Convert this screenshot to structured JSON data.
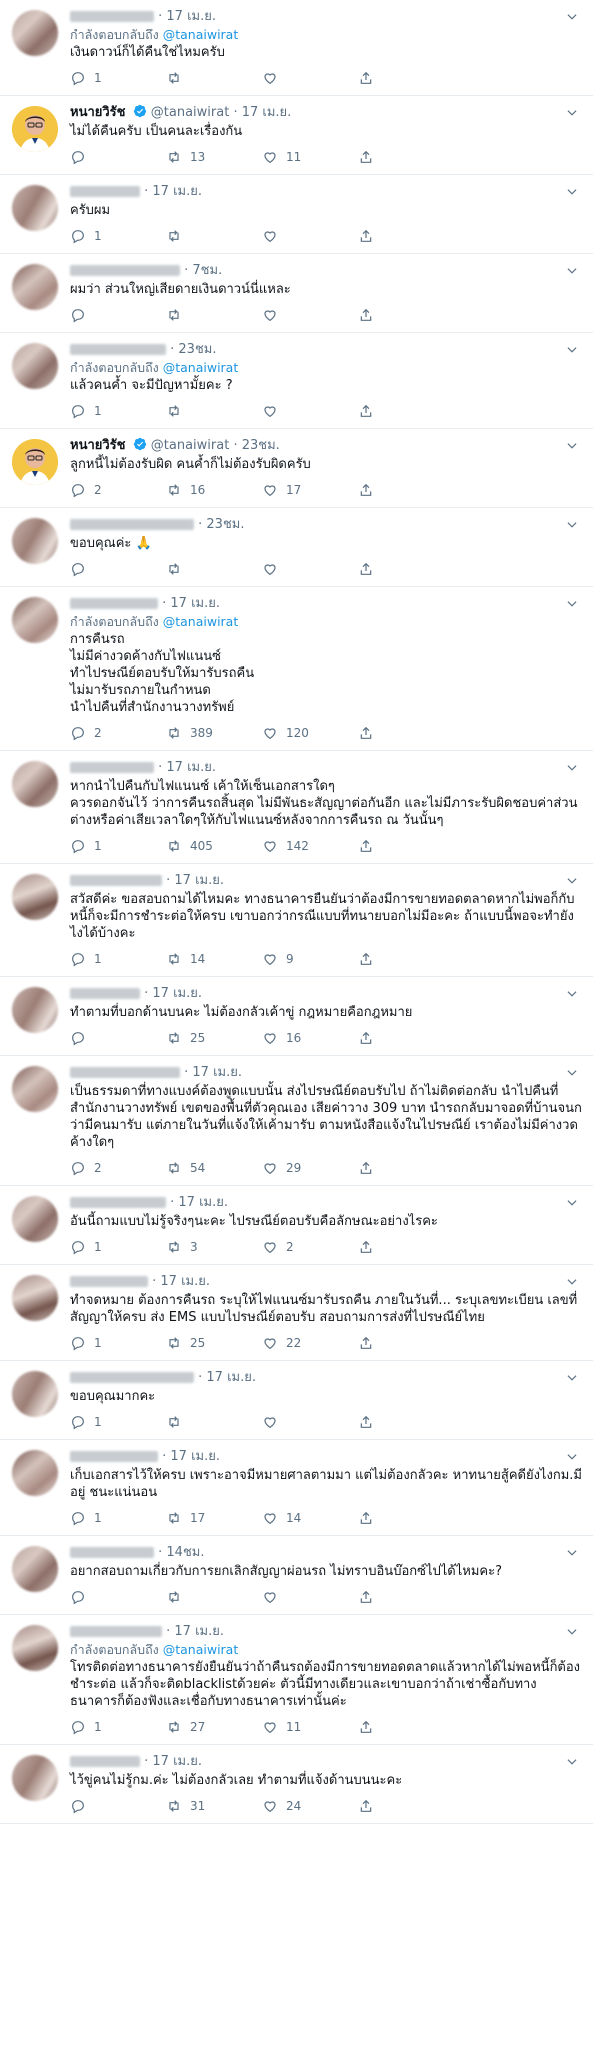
{
  "reply_prefix": "กำลังตอบกลับถึง",
  "reply_handle": "@tanaiwirat",
  "tweets": [
    {
      "name": "",
      "handle": "",
      "time": "17 เม.ย.",
      "reply": true,
      "text": "เงินดาวน์ก็ได้คืนใช่ไหมครับ",
      "replies": "1",
      "retweets": "",
      "likes": "",
      "avatar": "blur"
    },
    {
      "name": "หนายวิรัช",
      "handle": "@tanaiwirat",
      "time": "17 เม.ย.",
      "reply": false,
      "text": "ไม่ได้คืนครับ เป็นคนละเรื่องกัน",
      "replies": "",
      "retweets": "13",
      "likes": "11",
      "avatar": "person"
    },
    {
      "name": "",
      "handle": "",
      "time": "17 เม.ย.",
      "reply": false,
      "text": "ครับผม",
      "replies": "1",
      "retweets": "",
      "likes": "",
      "avatar": "blur"
    },
    {
      "name": "",
      "handle": "",
      "time": "7ชม.",
      "reply": false,
      "text": "ผมว่า ส่วนใหญ่เสียดายเงินดาวน์นี่แหละ",
      "replies": "",
      "retweets": "",
      "likes": "",
      "avatar": "blur"
    },
    {
      "name": "",
      "handle": "",
      "time": "23ชม.",
      "reply": true,
      "text": "แล้วคนค้ำ จะมีปัญหามั้ยคะ ?",
      "replies": "1",
      "retweets": "",
      "likes": "",
      "avatar": "blur"
    },
    {
      "name": "หนายวิรัช",
      "handle": "@tanaiwirat",
      "time": "23ชม.",
      "reply": false,
      "text": "ลูกหนี้ไม่ต้องรับผิด คนค้ำก็ไม่ต้องรับผิดครับ",
      "replies": "2",
      "retweets": "16",
      "likes": "17",
      "avatar": "person"
    },
    {
      "name": "",
      "handle": "",
      "time": "23ชม.",
      "reply": false,
      "text": "ขอบคุณค่ะ 🙏",
      "replies": "",
      "retweets": "",
      "likes": "",
      "avatar": "blur"
    },
    {
      "name": "",
      "handle": "",
      "time": "17 เม.ย.",
      "reply": true,
      "text": "การคืนรถ\nไม่มีค่างวดค้างกับไฟแนนซ์\nทำไปรษณีย์ตอบรับให้มารับรถคืน\nไม่มารับรถภายในกำหนด\nนำไปคืนที่สำนักงานวางทรัพย์",
      "replies": "2",
      "retweets": "389",
      "likes": "120",
      "avatar": "blur"
    },
    {
      "name": "",
      "handle": "",
      "time": "17 เม.ย.",
      "reply": false,
      "text": "หากนำไปคืนกับไฟแนนซ์ เค้าให้เซ็นเอกสารใดๆ\nควรดอกจันไว้ ว่าการคืนรถสิ้นสุด ไม่มีพันธะสัญญาต่อกันอีก และไม่มีภาระรับผิดชอบค่าส่วนต่างหรือค่าเสียเวลาใดๆให้กับไฟแนนซ์หลังจากการคืนรถ ณ วันนั้นๆ",
      "replies": "1",
      "retweets": "405",
      "likes": "142",
      "avatar": "blur"
    },
    {
      "name": "",
      "handle": "",
      "time": "17 เม.ย.",
      "reply": false,
      "text": "สวัสดีค่ะ ขอสอบถามได้ไหมคะ ทางธนาคารยืนยันว่าต้องมีการขายทอดตลาดหากไม่พอก็กับหนี้ก็จะมีการชำระต่อให้ครบ เขาบอกว่ากรณีแบบที่ทนายบอกไม่มีอะคะ ถ้าแบบนี้พอจะทำยังไงได้บ้างคะ",
      "replies": "1",
      "retweets": "14",
      "likes": "9",
      "avatar": "blur"
    },
    {
      "name": "",
      "handle": "",
      "time": "17 เม.ย.",
      "reply": false,
      "text": "ทำตามที่บอกด้านบนคะ ไม่ต้องกลัวเค้าขู่ กฎหมายคือกฎหมาย",
      "replies": "",
      "retweets": "25",
      "likes": "16",
      "avatar": "blur"
    },
    {
      "name": "",
      "handle": "",
      "time": "17 เม.ย.",
      "reply": false,
      "text": "เป็นธรรมดาที่ทางแบงค์ต้องพูดแบบนั้น ส่งไปรษณีย์ตอบรับไป ถ้าไม่ติดต่อกลับ นำไปคืนที่สำนักงานวางทรัพย์ เขตของพื้นที่ตัวคุณเอง เสียค่าวาง 309 บาท นำรถกลับมาจอดที่บ้านจนกว่ามีคนมารับ แต่ภายในวันที่แจ้งให้เค้ามารับ ตามหนังสือแจ้งในไปรษณีย์ เราต้องไม่มีค่างวดค้างใดๆ",
      "replies": "2",
      "retweets": "54",
      "likes": "29",
      "avatar": "blur"
    },
    {
      "name": "",
      "handle": "",
      "time": "17 เม.ย.",
      "reply": false,
      "text": "อันนี้ถามแบบไม่รู้จริงๆนะคะ ไปรษณีย์ตอบรับคือลักษณะอย่างไรคะ",
      "replies": "1",
      "retweets": "3",
      "likes": "2",
      "avatar": "blur"
    },
    {
      "name": "",
      "handle": "",
      "time": "17 เม.ย.",
      "reply": false,
      "text": "ทำจดหมาย ต้องการคืนรถ ระบุให้ไฟแนนซ์มารับรถคืน ภายในวันที่... ระบุเลขทะเบียน เลขที่สัญญาให้ครบ ส่ง EMS แบบไปรษณีย์ตอบรับ สอบถามการส่งที่ไปรษณีย์ไทย",
      "replies": "1",
      "retweets": "25",
      "likes": "22",
      "avatar": "blur"
    },
    {
      "name": "",
      "handle": "",
      "time": "17 เม.ย.",
      "reply": false,
      "text": "ขอบคุณมากคะ",
      "replies": "1",
      "retweets": "",
      "likes": "",
      "avatar": "blur"
    },
    {
      "name": "",
      "handle": "",
      "time": "17 เม.ย.",
      "reply": false,
      "text": "เก็บเอกสารไว้ให้ครบ เพราะอาจมีหมายศาลตามมา แต่ไม่ต้องกลัวคะ หาทนายสู้คดียังไงกม.มีอยู่ ชนะแน่นอน",
      "replies": "1",
      "retweets": "17",
      "likes": "14",
      "avatar": "blur"
    },
    {
      "name": "",
      "handle": "",
      "time": "14ชม.",
      "reply": false,
      "text": "อยากสอบถามเกี่ยวกับการยกเลิกสัญญาผ่อนรถ ไม่ทราบอินบ๊อกซ์ไปได้ไหมคะ?",
      "replies": "",
      "retweets": "",
      "likes": "",
      "avatar": "blur"
    },
    {
      "name": "",
      "handle": "",
      "time": "17 เม.ย.",
      "reply": true,
      "text": "โทรติดต่อทางธนาคารยังยืนยันว่าถ้าคืนรถต้องมีการขายทอดตลาดแล้วหากได้ไม่พอหนี้ก็ต้องชำระต่อ แล้วก็จะติดblacklistด้วยค่ะ ตัวนี้มีทางเดียวและเขาบอกว่าถ้าเช่าซื้อกับทางธนาคารก็ต้องฟังและเชื่อกับทางธนาคารเท่านั้นค่ะ",
      "replies": "1",
      "retweets": "27",
      "likes": "11",
      "avatar": "blur"
    },
    {
      "name": "",
      "handle": "",
      "time": "17 เม.ย.",
      "reply": false,
      "text": "ไว้ขู่คนไม่รู้กม.ค่ะ ไม่ต้องกลัวเลย ทำตามที่แจ้งด้านบนนะคะ",
      "replies": "",
      "retweets": "31",
      "likes": "24",
      "avatar": "blur"
    }
  ]
}
